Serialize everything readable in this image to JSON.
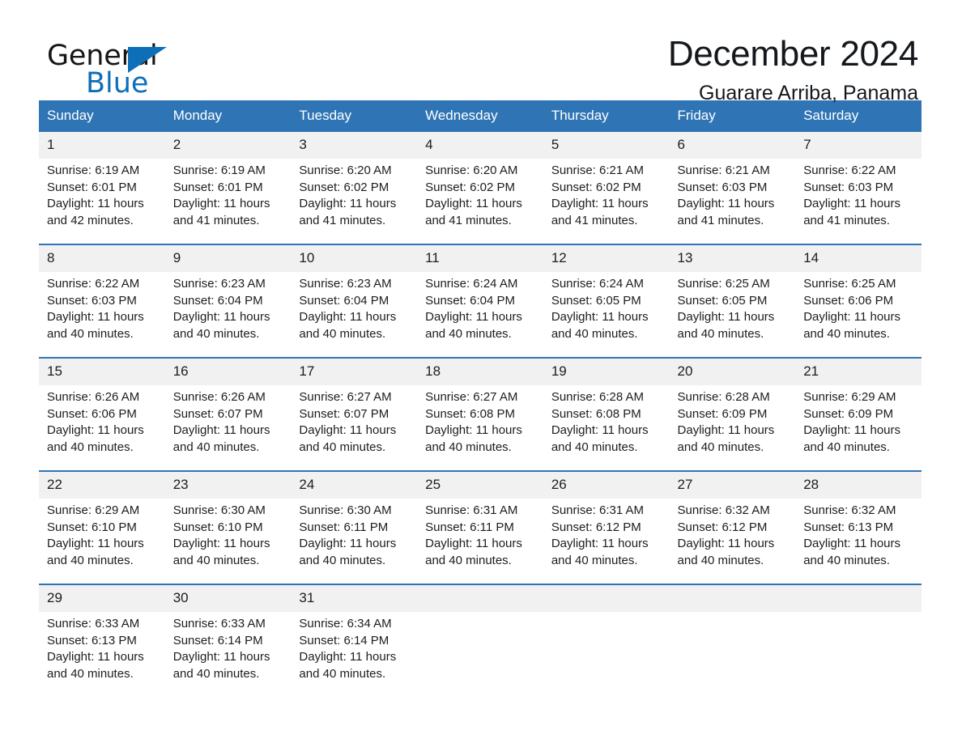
{
  "brand": {
    "name_part1": "General",
    "name_part2": "Blue",
    "triangle_icon": "triangle-logo-icon",
    "accent_color": "#0d6fb8"
  },
  "header": {
    "title": "December 2024",
    "subtitle": "Guarare Arriba, Panama"
  },
  "colors": {
    "header_blue": "#2f75b5",
    "date_band_gray": "#f1f1f1",
    "text": "#1d1d1d"
  },
  "calendar": {
    "weekday_headers": [
      "Sunday",
      "Monday",
      "Tuesday",
      "Wednesday",
      "Thursday",
      "Friday",
      "Saturday"
    ],
    "weeks": [
      {
        "dates": [
          "1",
          "2",
          "3",
          "4",
          "5",
          "6",
          "7"
        ],
        "cells": [
          {
            "sunrise": "Sunrise: 6:19 AM",
            "sunset": "Sunset: 6:01 PM",
            "daylight1": "Daylight: 11 hours",
            "daylight2": "and 42 minutes."
          },
          {
            "sunrise": "Sunrise: 6:19 AM",
            "sunset": "Sunset: 6:01 PM",
            "daylight1": "Daylight: 11 hours",
            "daylight2": "and 41 minutes."
          },
          {
            "sunrise": "Sunrise: 6:20 AM",
            "sunset": "Sunset: 6:02 PM",
            "daylight1": "Daylight: 11 hours",
            "daylight2": "and 41 minutes."
          },
          {
            "sunrise": "Sunrise: 6:20 AM",
            "sunset": "Sunset: 6:02 PM",
            "daylight1": "Daylight: 11 hours",
            "daylight2": "and 41 minutes."
          },
          {
            "sunrise": "Sunrise: 6:21 AM",
            "sunset": "Sunset: 6:02 PM",
            "daylight1": "Daylight: 11 hours",
            "daylight2": "and 41 minutes."
          },
          {
            "sunrise": "Sunrise: 6:21 AM",
            "sunset": "Sunset: 6:03 PM",
            "daylight1": "Daylight: 11 hours",
            "daylight2": "and 41 minutes."
          },
          {
            "sunrise": "Sunrise: 6:22 AM",
            "sunset": "Sunset: 6:03 PM",
            "daylight1": "Daylight: 11 hours",
            "daylight2": "and 41 minutes."
          }
        ]
      },
      {
        "dates": [
          "8",
          "9",
          "10",
          "11",
          "12",
          "13",
          "14"
        ],
        "cells": [
          {
            "sunrise": "Sunrise: 6:22 AM",
            "sunset": "Sunset: 6:03 PM",
            "daylight1": "Daylight: 11 hours",
            "daylight2": "and 40 minutes."
          },
          {
            "sunrise": "Sunrise: 6:23 AM",
            "sunset": "Sunset: 6:04 PM",
            "daylight1": "Daylight: 11 hours",
            "daylight2": "and 40 minutes."
          },
          {
            "sunrise": "Sunrise: 6:23 AM",
            "sunset": "Sunset: 6:04 PM",
            "daylight1": "Daylight: 11 hours",
            "daylight2": "and 40 minutes."
          },
          {
            "sunrise": "Sunrise: 6:24 AM",
            "sunset": "Sunset: 6:04 PM",
            "daylight1": "Daylight: 11 hours",
            "daylight2": "and 40 minutes."
          },
          {
            "sunrise": "Sunrise: 6:24 AM",
            "sunset": "Sunset: 6:05 PM",
            "daylight1": "Daylight: 11 hours",
            "daylight2": "and 40 minutes."
          },
          {
            "sunrise": "Sunrise: 6:25 AM",
            "sunset": "Sunset: 6:05 PM",
            "daylight1": "Daylight: 11 hours",
            "daylight2": "and 40 minutes."
          },
          {
            "sunrise": "Sunrise: 6:25 AM",
            "sunset": "Sunset: 6:06 PM",
            "daylight1": "Daylight: 11 hours",
            "daylight2": "and 40 minutes."
          }
        ]
      },
      {
        "dates": [
          "15",
          "16",
          "17",
          "18",
          "19",
          "20",
          "21"
        ],
        "cells": [
          {
            "sunrise": "Sunrise: 6:26 AM",
            "sunset": "Sunset: 6:06 PM",
            "daylight1": "Daylight: 11 hours",
            "daylight2": "and 40 minutes."
          },
          {
            "sunrise": "Sunrise: 6:26 AM",
            "sunset": "Sunset: 6:07 PM",
            "daylight1": "Daylight: 11 hours",
            "daylight2": "and 40 minutes."
          },
          {
            "sunrise": "Sunrise: 6:27 AM",
            "sunset": "Sunset: 6:07 PM",
            "daylight1": "Daylight: 11 hours",
            "daylight2": "and 40 minutes."
          },
          {
            "sunrise": "Sunrise: 6:27 AM",
            "sunset": "Sunset: 6:08 PM",
            "daylight1": "Daylight: 11 hours",
            "daylight2": "and 40 minutes."
          },
          {
            "sunrise": "Sunrise: 6:28 AM",
            "sunset": "Sunset: 6:08 PM",
            "daylight1": "Daylight: 11 hours",
            "daylight2": "and 40 minutes."
          },
          {
            "sunrise": "Sunrise: 6:28 AM",
            "sunset": "Sunset: 6:09 PM",
            "daylight1": "Daylight: 11 hours",
            "daylight2": "and 40 minutes."
          },
          {
            "sunrise": "Sunrise: 6:29 AM",
            "sunset": "Sunset: 6:09 PM",
            "daylight1": "Daylight: 11 hours",
            "daylight2": "and 40 minutes."
          }
        ]
      },
      {
        "dates": [
          "22",
          "23",
          "24",
          "25",
          "26",
          "27",
          "28"
        ],
        "cells": [
          {
            "sunrise": "Sunrise: 6:29 AM",
            "sunset": "Sunset: 6:10 PM",
            "daylight1": "Daylight: 11 hours",
            "daylight2": "and 40 minutes."
          },
          {
            "sunrise": "Sunrise: 6:30 AM",
            "sunset": "Sunset: 6:10 PM",
            "daylight1": "Daylight: 11 hours",
            "daylight2": "and 40 minutes."
          },
          {
            "sunrise": "Sunrise: 6:30 AM",
            "sunset": "Sunset: 6:11 PM",
            "daylight1": "Daylight: 11 hours",
            "daylight2": "and 40 minutes."
          },
          {
            "sunrise": "Sunrise: 6:31 AM",
            "sunset": "Sunset: 6:11 PM",
            "daylight1": "Daylight: 11 hours",
            "daylight2": "and 40 minutes."
          },
          {
            "sunrise": "Sunrise: 6:31 AM",
            "sunset": "Sunset: 6:12 PM",
            "daylight1": "Daylight: 11 hours",
            "daylight2": "and 40 minutes."
          },
          {
            "sunrise": "Sunrise: 6:32 AM",
            "sunset": "Sunset: 6:12 PM",
            "daylight1": "Daylight: 11 hours",
            "daylight2": "and 40 minutes."
          },
          {
            "sunrise": "Sunrise: 6:32 AM",
            "sunset": "Sunset: 6:13 PM",
            "daylight1": "Daylight: 11 hours",
            "daylight2": "and 40 minutes."
          }
        ]
      },
      {
        "dates": [
          "29",
          "30",
          "31",
          "",
          "",
          "",
          ""
        ],
        "cells": [
          {
            "sunrise": "Sunrise: 6:33 AM",
            "sunset": "Sunset: 6:13 PM",
            "daylight1": "Daylight: 11 hours",
            "daylight2": "and 40 minutes."
          },
          {
            "sunrise": "Sunrise: 6:33 AM",
            "sunset": "Sunset: 6:14 PM",
            "daylight1": "Daylight: 11 hours",
            "daylight2": "and 40 minutes."
          },
          {
            "sunrise": "Sunrise: 6:34 AM",
            "sunset": "Sunset: 6:14 PM",
            "daylight1": "Daylight: 11 hours",
            "daylight2": "and 40 minutes."
          },
          {
            "sunrise": "",
            "sunset": "",
            "daylight1": "",
            "daylight2": ""
          },
          {
            "sunrise": "",
            "sunset": "",
            "daylight1": "",
            "daylight2": ""
          },
          {
            "sunrise": "",
            "sunset": "",
            "daylight1": "",
            "daylight2": ""
          },
          {
            "sunrise": "",
            "sunset": "",
            "daylight1": "",
            "daylight2": ""
          }
        ]
      }
    ]
  }
}
